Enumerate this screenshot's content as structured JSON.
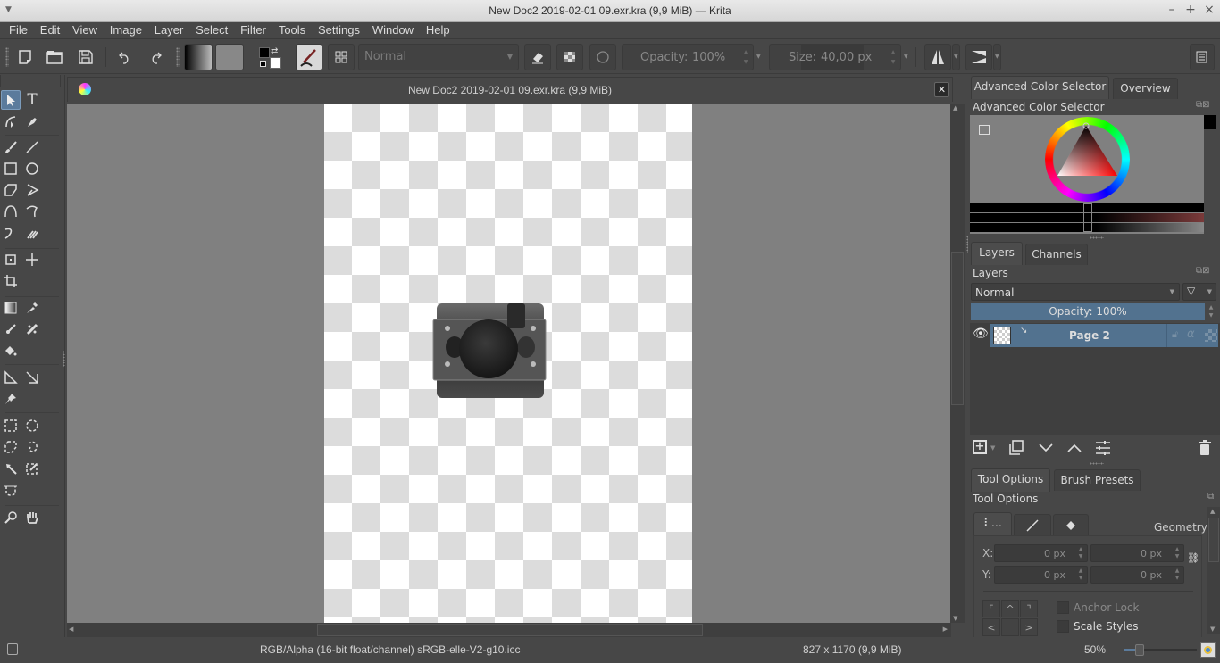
{
  "window": {
    "title": "New Doc2 2019-02-01 09.exr.kra (9,9 MiB) — Krita",
    "controls": [
      "minimize",
      "maximize",
      "close"
    ]
  },
  "menubar": {
    "items": [
      "File",
      "Edit",
      "View",
      "Image",
      "Layer",
      "Select",
      "Filter",
      "Tools",
      "Settings",
      "Window",
      "Help"
    ]
  },
  "toolbar": {
    "blend_mode": "Normal",
    "opacity_label": "Opacity:",
    "opacity_value": "100%",
    "size_label": "Size:",
    "size_value": "40,00 px",
    "icons": [
      "new-document-icon",
      "open-icon",
      "save-icon",
      "undo-icon",
      "redo-icon",
      "gradient-icon",
      "pattern-icon",
      "foreground-background-colors-icon",
      "brush-preset-icon",
      "workspace-grid-icon",
      "eraser-icon",
      "preserve-alpha-icon",
      "reload-preset-icon",
      "mirror-horizontal-icon",
      "mirror-vertical-icon",
      "docker-menu-icon"
    ],
    "colors": {
      "foreground": "#000000",
      "background": "#ffffff"
    }
  },
  "toolbox": {
    "tools": [
      "select-shapes",
      "text",
      "edit-shapes",
      "calligraphy",
      "freehand-brush",
      "line",
      "rectangle",
      "ellipse",
      "polygon",
      "polyline",
      "bezier-curve",
      "freehand-path",
      "dynamic-brush",
      "multibrush",
      "transform",
      "move",
      "crop",
      "gradient",
      "color-picker",
      "colorize-mask",
      "smart-patch",
      "fill",
      "assistant",
      "measure",
      "reference-images",
      "rectangular-selection",
      "elliptical-selection",
      "polygonal-selection",
      "freehand-selection",
      "contiguous-selection",
      "similar-color-selection",
      "bezier-selection",
      "zoom",
      "pan"
    ],
    "active_tool": "select-shapes"
  },
  "document": {
    "title": "New Doc2 2019-02-01 09.exr.kra (9,9 MiB)"
  },
  "dockers": {
    "color_tabs": [
      "Advanced Color Selector",
      "Overview"
    ],
    "color_title": "Advanced Color Selector",
    "hsv": {
      "hue": 0,
      "selected_color": "#000000"
    },
    "layers_tabs": [
      "Layers",
      "Channels"
    ],
    "layers_title": "Layers",
    "layers_blend": "Normal",
    "layers_opacity": "Opacity:  100%",
    "layers": [
      {
        "name": "Page 2",
        "visible": true,
        "selected": true
      }
    ],
    "options_tabs": [
      "Tool Options",
      "Brush Presets"
    ],
    "options_title": "Tool Options",
    "geometry_label": "Geometry",
    "x_label": "X:",
    "y_label": "Y:",
    "x_value": "0 px",
    "x2_value": "0 px",
    "y_value": "0 px",
    "y2_value": "0 px",
    "anchor_lock": "Anchor Lock",
    "scale_styles": "Scale Styles"
  },
  "statusbar": {
    "color_profile": "RGB/Alpha (16-bit float/channel)  sRGB-elle-V2-g10.icc",
    "image_size": "827 x 1170 (9,9 MiB)",
    "zoom": "50%",
    "zoom_fraction": 0.5
  }
}
